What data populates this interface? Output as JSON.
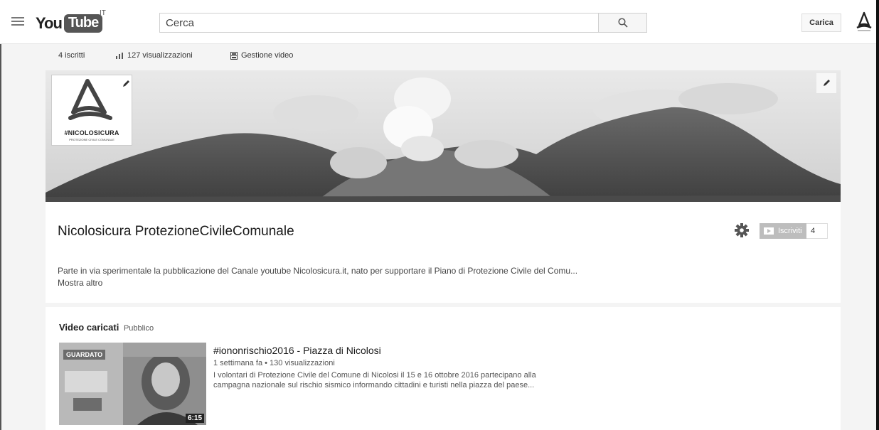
{
  "header": {
    "logo_you": "You",
    "logo_tube": "Tube",
    "country": "IT",
    "search_placeholder": "Cerca",
    "upload_label": "Carica"
  },
  "stats": {
    "subscribers": "4 iscritti",
    "views": "127 visualizzazioni",
    "manage": "Gestione video"
  },
  "channel": {
    "logo_tag": "#NICOLOSICURA",
    "logo_subtag": "PROTEZIONE CIVILE COMUNALE",
    "title": "Nicolosicura ProtezioneCivileComunale",
    "subscribe_label": "Iscriviti",
    "subscriber_count": "4",
    "description": "Parte in via sperimentale la pubblicazione del Canale youtube Nicolosicura.it, nato per supportare il Piano di Protezione Civile del Comu...",
    "show_more": "Mostra altro"
  },
  "uploads": {
    "section_title": "Video caricati",
    "privacy": "Pubblico",
    "videos": [
      {
        "title": "#iononrischio2016 - Piazza di Nicolosi",
        "meta": "1 settimana fa • 130 visualizzazioni",
        "description_line1": "I volontari di Protezione Civile del Comune di Nicolosi il 15 e 16 ottobre 2016 partecipano alla",
        "description_line2": "campagna nazionale sul rischio sismico informando cittadini e turisti nella piazza del paese...",
        "watched_badge": "GUARDATO",
        "duration": "6:15"
      }
    ]
  },
  "colors": {
    "subscribe_bg": "#bdbdbd",
    "page_bg": "#f4f4f4"
  }
}
